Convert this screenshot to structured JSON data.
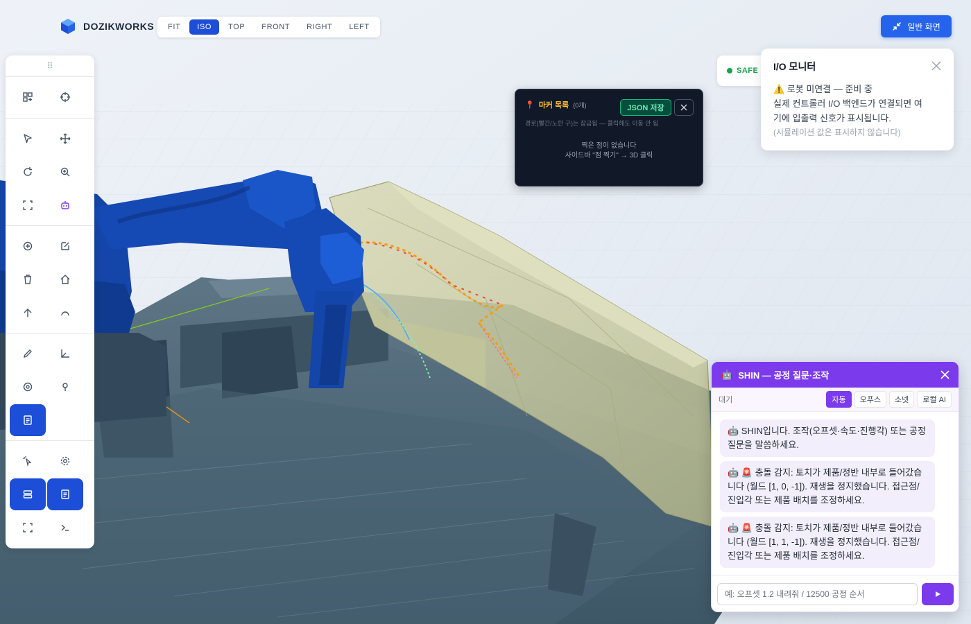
{
  "brand": {
    "name": "DOZIKWORKS",
    "icon": "cube-logo-icon"
  },
  "view_tabs": [
    {
      "label": "FIT",
      "active": false
    },
    {
      "label": "ISO",
      "active": true
    },
    {
      "label": "TOP",
      "active": false
    },
    {
      "label": "FRONT",
      "active": false
    },
    {
      "label": "RIGHT",
      "active": false
    },
    {
      "label": "LEFT",
      "active": false
    }
  ],
  "normal_view_button": {
    "label": "일반 화면",
    "icon": "collapse-icon"
  },
  "toolbar": {
    "grip": "⠿",
    "buttons": [
      {
        "name": "add-layout",
        "icon": "layout-add-icon",
        "active": false
      },
      {
        "name": "crosshair",
        "icon": "crosshair-icon",
        "active": false
      },
      {
        "name": "select",
        "icon": "pointer-icon",
        "active": false
      },
      {
        "name": "move",
        "icon": "move-icon",
        "active": false
      },
      {
        "name": "rotate",
        "icon": "rotate-icon",
        "active": false
      },
      {
        "name": "zoom",
        "icon": "zoom-icon",
        "active": false
      },
      {
        "name": "fit-frame",
        "icon": "frame-icon",
        "active": false
      },
      {
        "name": "robot",
        "icon": "robot-icon",
        "active": false
      },
      {
        "name": "add",
        "icon": "plus-circle-icon",
        "active": false
      },
      {
        "name": "edit",
        "icon": "edit-icon",
        "active": false
      },
      {
        "name": "delete",
        "icon": "trash-icon",
        "active": false
      },
      {
        "name": "home",
        "icon": "home-icon",
        "active": false
      },
      {
        "name": "up-arrow",
        "icon": "arrow-up-icon",
        "active": false
      },
      {
        "name": "arc",
        "icon": "arc-icon",
        "active": false
      },
      {
        "name": "pencil",
        "icon": "pencil-icon",
        "active": false
      },
      {
        "name": "axis",
        "icon": "axis-icon",
        "active": false
      },
      {
        "name": "target",
        "icon": "target-icon",
        "active": false
      },
      {
        "name": "pin",
        "icon": "pin-icon",
        "active": false
      },
      {
        "name": "notes",
        "icon": "notes-icon",
        "active": true
      },
      {
        "name": "cursor-click",
        "icon": "cursor-click-icon",
        "active": false
      },
      {
        "name": "settings",
        "icon": "gear-icon",
        "active": false
      },
      {
        "name": "storage",
        "icon": "storage-icon",
        "active": true
      },
      {
        "name": "document",
        "icon": "document-icon",
        "active": true
      },
      {
        "name": "fullscreen",
        "icon": "fullscreen-icon",
        "active": false
      },
      {
        "name": "terminal",
        "icon": "terminal-icon",
        "active": false
      }
    ]
  },
  "safe_badge": {
    "label": "SAFE",
    "color": "#16a34a"
  },
  "io_monitor": {
    "title": "I/O 모니터",
    "status_icon": "⚠️",
    "status": "로봇 미연결 — 준비 중",
    "line2": "실제 컨트롤러 I/O 백엔드가 연결되면 여",
    "line3": "기에 입출력 신호가 표시됩니다.",
    "note": "(시뮬레이션 값은 표시하지 않습니다)"
  },
  "marker_panel": {
    "pin": "📍",
    "title": "마커 목록",
    "count": "(0개)",
    "json_button": "JSON 저장",
    "hint": "경로(빨간/노란 구)는 잠금됨 — 클릭해도 이동 안 됨",
    "empty_line1": "찍은 점이 없습니다",
    "empty_line2": "사이드바 \"점 찍기\" → 3D 클릭"
  },
  "chat": {
    "robot": "🤖",
    "title": "SHIN — 공정 질문·조작",
    "status": "대기",
    "modes": [
      {
        "label": "자동",
        "active": true
      },
      {
        "label": "오푸스",
        "active": false
      },
      {
        "label": "소넷",
        "active": false
      },
      {
        "label": "로컬 AI",
        "active": false
      }
    ],
    "messages": [
      {
        "text": "🤖 SHIN입니다. 조작(오프셋·속도·진행각) 또는 공정 질문을 말씀하세요."
      },
      {
        "text": "🤖 🚨 충돌 감지: 토치가 제품/정반 내부로 들어갔습니다 (월드 [1, 0, -1]). 재생을 정지했습니다. 접근점/진입각 또는 제품 배치를 조정하세요."
      },
      {
        "text": "🤖 🚨 충돌 감지: 토치가 제품/정반 내부로 들어갔습니다 (월드 [1, 1, -1]). 재생을 정지했습니다. 접근점/진입각 또는 제품 배치를 조정하세요."
      }
    ],
    "input_placeholder": "예: 오프셋 1.2 내려줘 / 12500 공정 순서",
    "send_icon": "send-icon"
  },
  "colors": {
    "accent": "#1d4ed8",
    "chat_accent": "#7c3aed",
    "robot": "#1445a8",
    "part": "#cfd0a6",
    "table": "#3f5a6b"
  }
}
